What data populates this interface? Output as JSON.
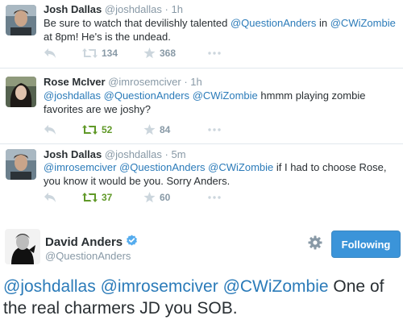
{
  "tweets": [
    {
      "name": "Josh Dallas",
      "handle": "@joshdallas",
      "separator": "·",
      "time": "1h",
      "text": [
        {
          "t": "Be sure to watch that devilishly talented ",
          "m": false
        },
        {
          "t": "@QuestionAnders",
          "m": true
        },
        {
          "t": " in ",
          "m": false
        },
        {
          "t": "@CWiZombie",
          "m": true
        },
        {
          "t": " at 8pm! He's is the undead.",
          "m": false
        }
      ],
      "retweets": "134",
      "favorites": "368",
      "retweeted": false
    },
    {
      "name": "Rose McIver",
      "handle": "@imrosemciver",
      "separator": "·",
      "time": "1h",
      "text": [
        {
          "t": "@joshdallas",
          "m": true
        },
        {
          "t": " ",
          "m": false
        },
        {
          "t": "@QuestionAnders",
          "m": true
        },
        {
          "t": " ",
          "m": false
        },
        {
          "t": "@CWiZombie",
          "m": true
        },
        {
          "t": " hmmm playing zombie favorites are we joshy?",
          "m": false
        }
      ],
      "retweets": "52",
      "favorites": "84",
      "retweeted": true
    },
    {
      "name": "Josh Dallas",
      "handle": "@joshdallas",
      "separator": "·",
      "time": "5m",
      "text": [
        {
          "t": "@imrosemciver",
          "m": true
        },
        {
          "t": " ",
          "m": false
        },
        {
          "t": "@QuestionAnders",
          "m": true
        },
        {
          "t": " ",
          "m": false
        },
        {
          "t": "@CWiZombie",
          "m": true
        },
        {
          "t": " if I had to choose Rose, you know it would be you. Sorry Anders.",
          "m": false
        }
      ],
      "retweets": "37",
      "favorites": "60",
      "retweeted": true
    }
  ],
  "main_tweet": {
    "name": "David Anders",
    "handle": "@QuestionAnders",
    "follow_label": "Following",
    "text": [
      {
        "t": "@joshdallas",
        "m": true
      },
      {
        "t": " ",
        "m": false
      },
      {
        "t": "@imrosemciver",
        "m": true
      },
      {
        "t": " ",
        "m": false
      },
      {
        "t": "@CWiZombie",
        "m": true
      },
      {
        "t": " One of the real charmers JD you SOB.",
        "m": false
      }
    ]
  },
  "icons": {
    "reply": "reply-icon",
    "retweet": "retweet-icon",
    "favorite": "star-icon",
    "more": "more-dots-icon",
    "verified": "verified-badge-icon",
    "gear": "gear-icon"
  },
  "colors": {
    "mention": "#2b7bb9",
    "retweet_active": "#609928",
    "muted": "#8899a6",
    "follow_button": "#3b94d9"
  }
}
